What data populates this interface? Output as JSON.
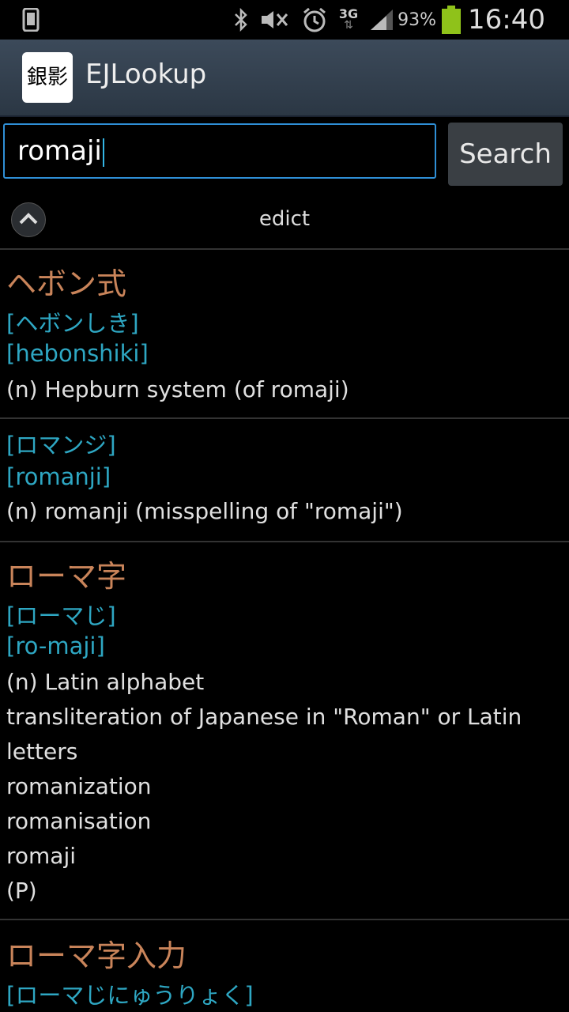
{
  "status_bar": {
    "battery_percent": "93%",
    "time": "16:40",
    "network": "3G",
    "icons": [
      "phone-icon",
      "bluetooth-icon",
      "mute-icon",
      "alarm-icon",
      "network-3g-icon",
      "signal-icon",
      "battery-icon"
    ]
  },
  "action_bar": {
    "app_icon_text": "銀影",
    "title": "EJLookup"
  },
  "search": {
    "value": "romaji",
    "button_label": "Search"
  },
  "dictionary": {
    "name": "edict"
  },
  "entries": [
    {
      "kanji": "ヘボン式",
      "reading": "[ヘボンしき]",
      "romaji": "[hebonshiki]",
      "defs": [
        "(n) Hepburn system (of romaji)"
      ]
    },
    {
      "kanji": "",
      "reading": "[ロマンジ]",
      "romaji": "[romanji]",
      "defs": [
        "(n) romanji (misspelling of \"romaji\")"
      ]
    },
    {
      "kanji": "ローマ字",
      "reading": "[ローマじ]",
      "romaji": "[ro-maji]",
      "defs": [
        "(n) Latin alphabet",
        "transliteration of Japanese in \"Roman\" or Latin",
        "letters",
        "romanization",
        "romanisation",
        "romaji",
        "(P)"
      ]
    },
    {
      "kanji": "ローマ字入力",
      "reading": "[ローマじにゅうりょく]",
      "romaji": "",
      "defs": []
    }
  ],
  "colors": {
    "kanji": "#c9845a",
    "reading": "#2ea7c3",
    "accent": "#2f8fd6"
  }
}
